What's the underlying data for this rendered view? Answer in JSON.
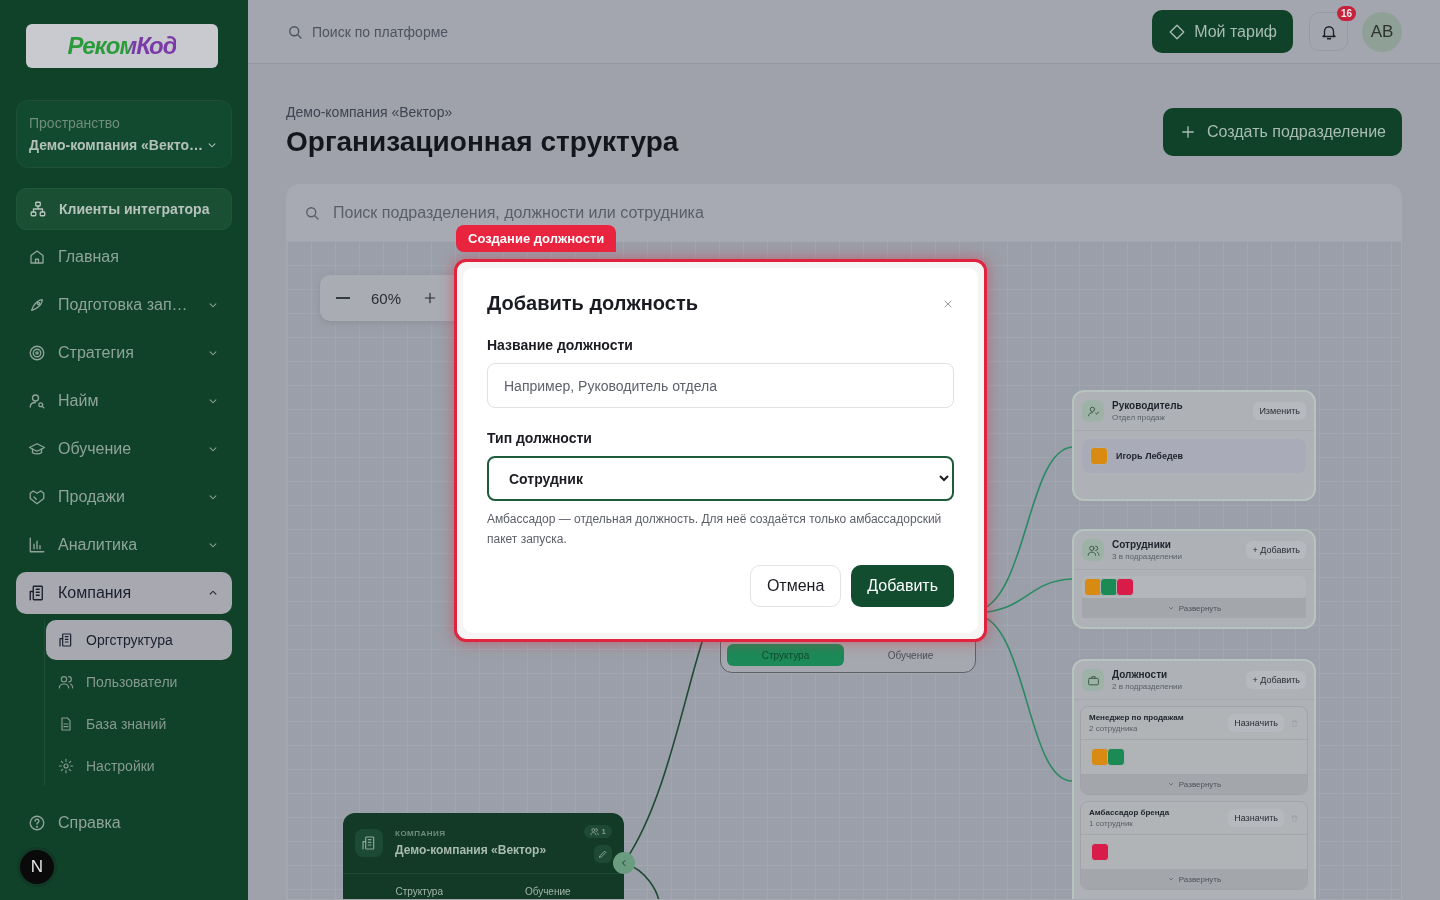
{
  "sidebar": {
    "logo": "РекомКод",
    "space": {
      "label": "Пространство",
      "value": "Демо-компания «Векто…"
    },
    "nav": [
      {
        "label": "Клиенты интегратора",
        "kind": "accent",
        "selected": false
      },
      {
        "label": "Главная",
        "kind": "link",
        "selected": false
      },
      {
        "label": "Подготовка зап…",
        "kind": "group",
        "expanded": false,
        "selected": false
      },
      {
        "label": "Стратегия",
        "kind": "group",
        "expanded": false,
        "selected": false
      },
      {
        "label": "Найм",
        "kind": "group",
        "expanded": false,
        "selected": false
      },
      {
        "label": "Обучение",
        "kind": "group",
        "expanded": false,
        "selected": false
      },
      {
        "label": "Продажи",
        "kind": "group",
        "expanded": false,
        "selected": false
      },
      {
        "label": "Аналитика",
        "kind": "group",
        "expanded": false,
        "selected": false
      },
      {
        "label": "Компания",
        "kind": "group",
        "expanded": true,
        "selected": true,
        "children": [
          {
            "label": "Оргструктура",
            "selected": true
          },
          {
            "label": "Пользователи",
            "selected": false
          },
          {
            "label": "База знаний",
            "selected": false
          },
          {
            "label": "Настройки",
            "selected": false
          }
        ]
      },
      {
        "label": "Справка",
        "kind": "link",
        "selected": false
      }
    ],
    "badge": "N"
  },
  "topbar": {
    "search": {
      "placeholder": "Поиск по платформе"
    },
    "plan_button": "Мой тариф",
    "notifications": "16",
    "avatar": "AB"
  },
  "page": {
    "breadcrumb": "Демо-компания «Вектор»",
    "title": "Организационная структура",
    "create_button": "Создать подразделение"
  },
  "org": {
    "search": {
      "placeholder": "Поиск подразделения, должности или сотрудника"
    },
    "zoom": "60%",
    "company_node": {
      "type": "КОМПАНИЯ",
      "name": "Демо-компания «Вектор»",
      "members": "1",
      "tabs": [
        {
          "label": "Структура",
          "selected": false
        },
        {
          "label": "Обучение",
          "selected": false
        }
      ]
    },
    "department_node": {
      "tabs": [
        {
          "label": "Структура",
          "selected": true
        },
        {
          "label": "Обучение",
          "selected": false
        }
      ]
    },
    "head_card": {
      "title": "Руководитель",
      "subtitle": "Отдел продаж",
      "button": "Изменить",
      "person": {
        "name": "Игорь Лебедев",
        "color": "#d98a12"
      }
    },
    "staff_card": {
      "title": "Сотрудники",
      "subtitle": "3 в подразделении",
      "button": "+ Добавить",
      "avatars": [
        {
          "color": "#d98a12"
        },
        {
          "color": "#1b8a55"
        },
        {
          "color": "#d81b48"
        }
      ],
      "expand": "Развернуть"
    },
    "positions_card": {
      "title": "Должности",
      "subtitle": "2 в подразделении",
      "button": "+ Добавить",
      "positions": [
        {
          "name": "Менеджер по продажам",
          "count": "2 сотрудника",
          "button": "Назначить",
          "avatars": [
            {
              "color": "#d98a12"
            },
            {
              "color": "#1b8a55"
            }
          ],
          "expand": "Развернуть"
        },
        {
          "name": "Амбассадор бренда",
          "count": "1 сотрудник",
          "button": "Назначить",
          "avatars": [
            {
              "color": "#d81b48"
            }
          ],
          "expand": "Развернуть"
        }
      ]
    }
  },
  "tour_tag": "Создание должности",
  "dialog": {
    "title": "Добавить должность",
    "name_label": "Название должности",
    "name_placeholder": "Например, Руководитель отдела",
    "type_label": "Тип должности",
    "type_value": "Сотрудник",
    "hint": "Амбассадор — отдельная должность. Для неё создаётся только амбассадорский пакет запуска.",
    "cancel": "Отмена",
    "submit": "Добавить"
  }
}
